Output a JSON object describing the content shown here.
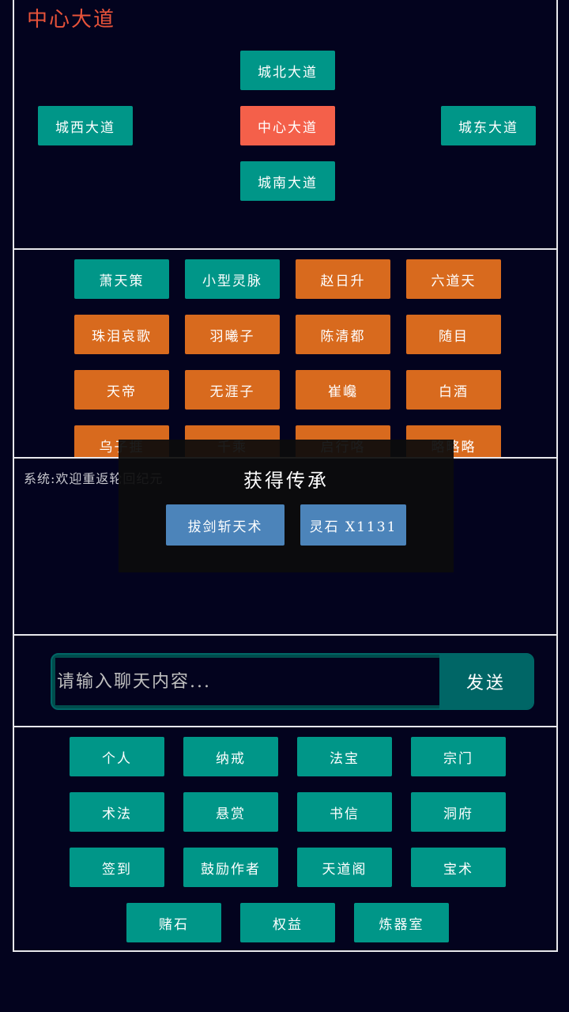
{
  "location": {
    "title": "中心大道",
    "north": "城北大道",
    "west": "城西大道",
    "center": "中心大道",
    "east": "城东大道",
    "south": "城南大道"
  },
  "players": [
    "萧天策",
    "小型灵脉",
    "赵日升",
    "六道天",
    "珠泪哀歌",
    "羽曦子",
    "陈清都",
    "随目",
    "天帝",
    "无涯子",
    "崔巉",
    "白酒",
    "乌子捱",
    "千乘",
    "启行咯",
    "略略略"
  ],
  "log": {
    "system_message": "系统:欢迎重返轮回纪元"
  },
  "modal": {
    "title": "获得传承",
    "reward_1": "拔剑斩天术",
    "reward_2": "灵石 X1131"
  },
  "chat": {
    "placeholder": "请输入聊天内容...",
    "send_label": "发送"
  },
  "menu": [
    "个人",
    "纳戒",
    "法宝",
    "宗门",
    "术法",
    "悬赏",
    "书信",
    "洞府",
    "签到",
    "鼓励作者",
    "天道阁",
    "宝术",
    "赌石",
    "权益",
    "炼器室"
  ],
  "colors": {
    "background": "#03031e",
    "teal": "#009688",
    "orange": "#d86a1e",
    "current_location": "#f4604a",
    "reward_blue": "#4c84ba",
    "title_red": "#e8533a"
  }
}
